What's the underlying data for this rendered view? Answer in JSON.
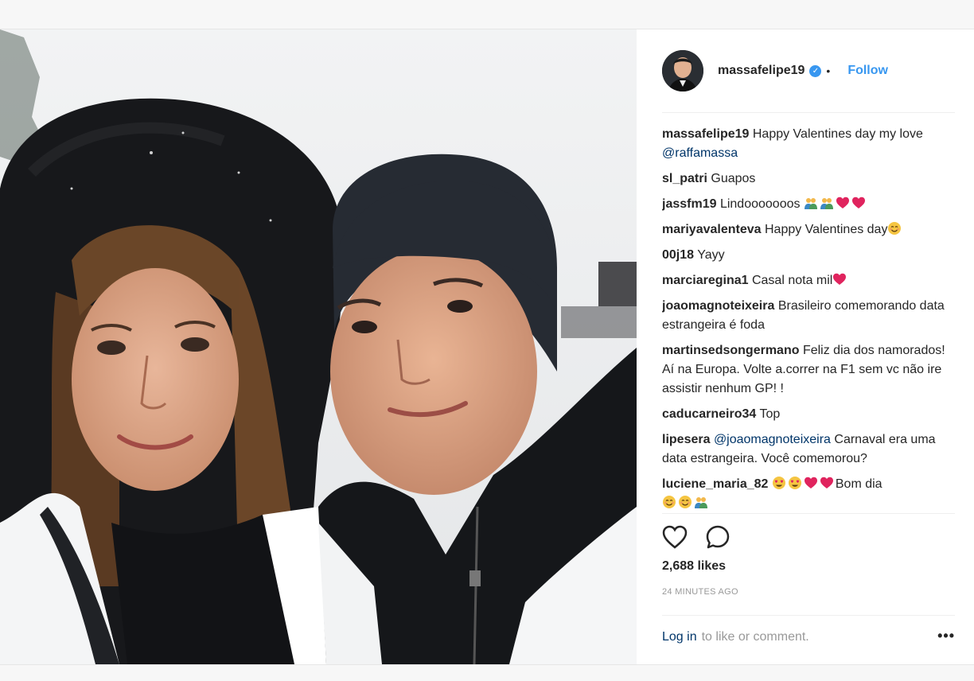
{
  "post": {
    "username": "massafelipe19",
    "follow_label": "Follow",
    "separator": "•",
    "likes": "2,688 likes",
    "time_ago": "24 MINUTES AGO",
    "login_label": "Log in",
    "login_suffix": "to like or comment.",
    "more_label": "•••"
  },
  "comments": [
    {
      "user": "massafelipe19",
      "text": "Happy Valentines day my love ",
      "mention": "@raffamassa",
      "after": "",
      "emojis": []
    },
    {
      "user": "sl_patri",
      "text": "Guapos",
      "mention": "",
      "after": "",
      "emojis": []
    },
    {
      "user": "jassfm19",
      "text": "Lindooooooos ",
      "mention": "",
      "after": "",
      "emojis": [
        "couple",
        "couple",
        "heart",
        "heart"
      ]
    },
    {
      "user": "mariyavalenteva",
      "text": "Happy Valentines day",
      "mention": "",
      "after": "",
      "emojis": [
        "blush"
      ]
    },
    {
      "user": "00j18",
      "text": "Yayy",
      "mention": "",
      "after": "",
      "emojis": []
    },
    {
      "user": "marciaregina1",
      "text": "Casal nota mil",
      "mention": "",
      "after": "",
      "emojis": [
        "heart"
      ]
    },
    {
      "user": "joaomagnoteixeira",
      "text": "Brasileiro comemorando data estrangeira é foda",
      "mention": "",
      "after": "",
      "emojis": []
    },
    {
      "user": "martinsedsongermano",
      "text": "Feliz dia dos namorados! Aí na Europa. Volte a.correr na F1 sem vc não ire assistir nenhum GP! !",
      "mention": "",
      "after": "",
      "emojis": []
    },
    {
      "user": "caducarneiro34",
      "text": "Top",
      "mention": "",
      "after": "",
      "emojis": []
    },
    {
      "user": "lipesera",
      "text": "",
      "mention": "@joaomagnoteixeira",
      "after": " Carnaval era uma data estrangeira. Você comemorou?",
      "emojis": []
    },
    {
      "user": "luciene_maria_82",
      "text": "",
      "mention": "",
      "after": "Bom dia",
      "emojis": [
        "hearteyes",
        "hearteyes",
        "heart",
        "heart"
      ],
      "trailing_emojis": [
        "blush",
        "blush",
        "couple"
      ]
    }
  ],
  "icons": {
    "like": "heart-outline-icon",
    "comment": "comment-bubble-icon",
    "verified": "verified-badge-icon"
  },
  "colors": {
    "link": "#3897f0",
    "mention": "#003569",
    "heart": "#e0245e"
  }
}
